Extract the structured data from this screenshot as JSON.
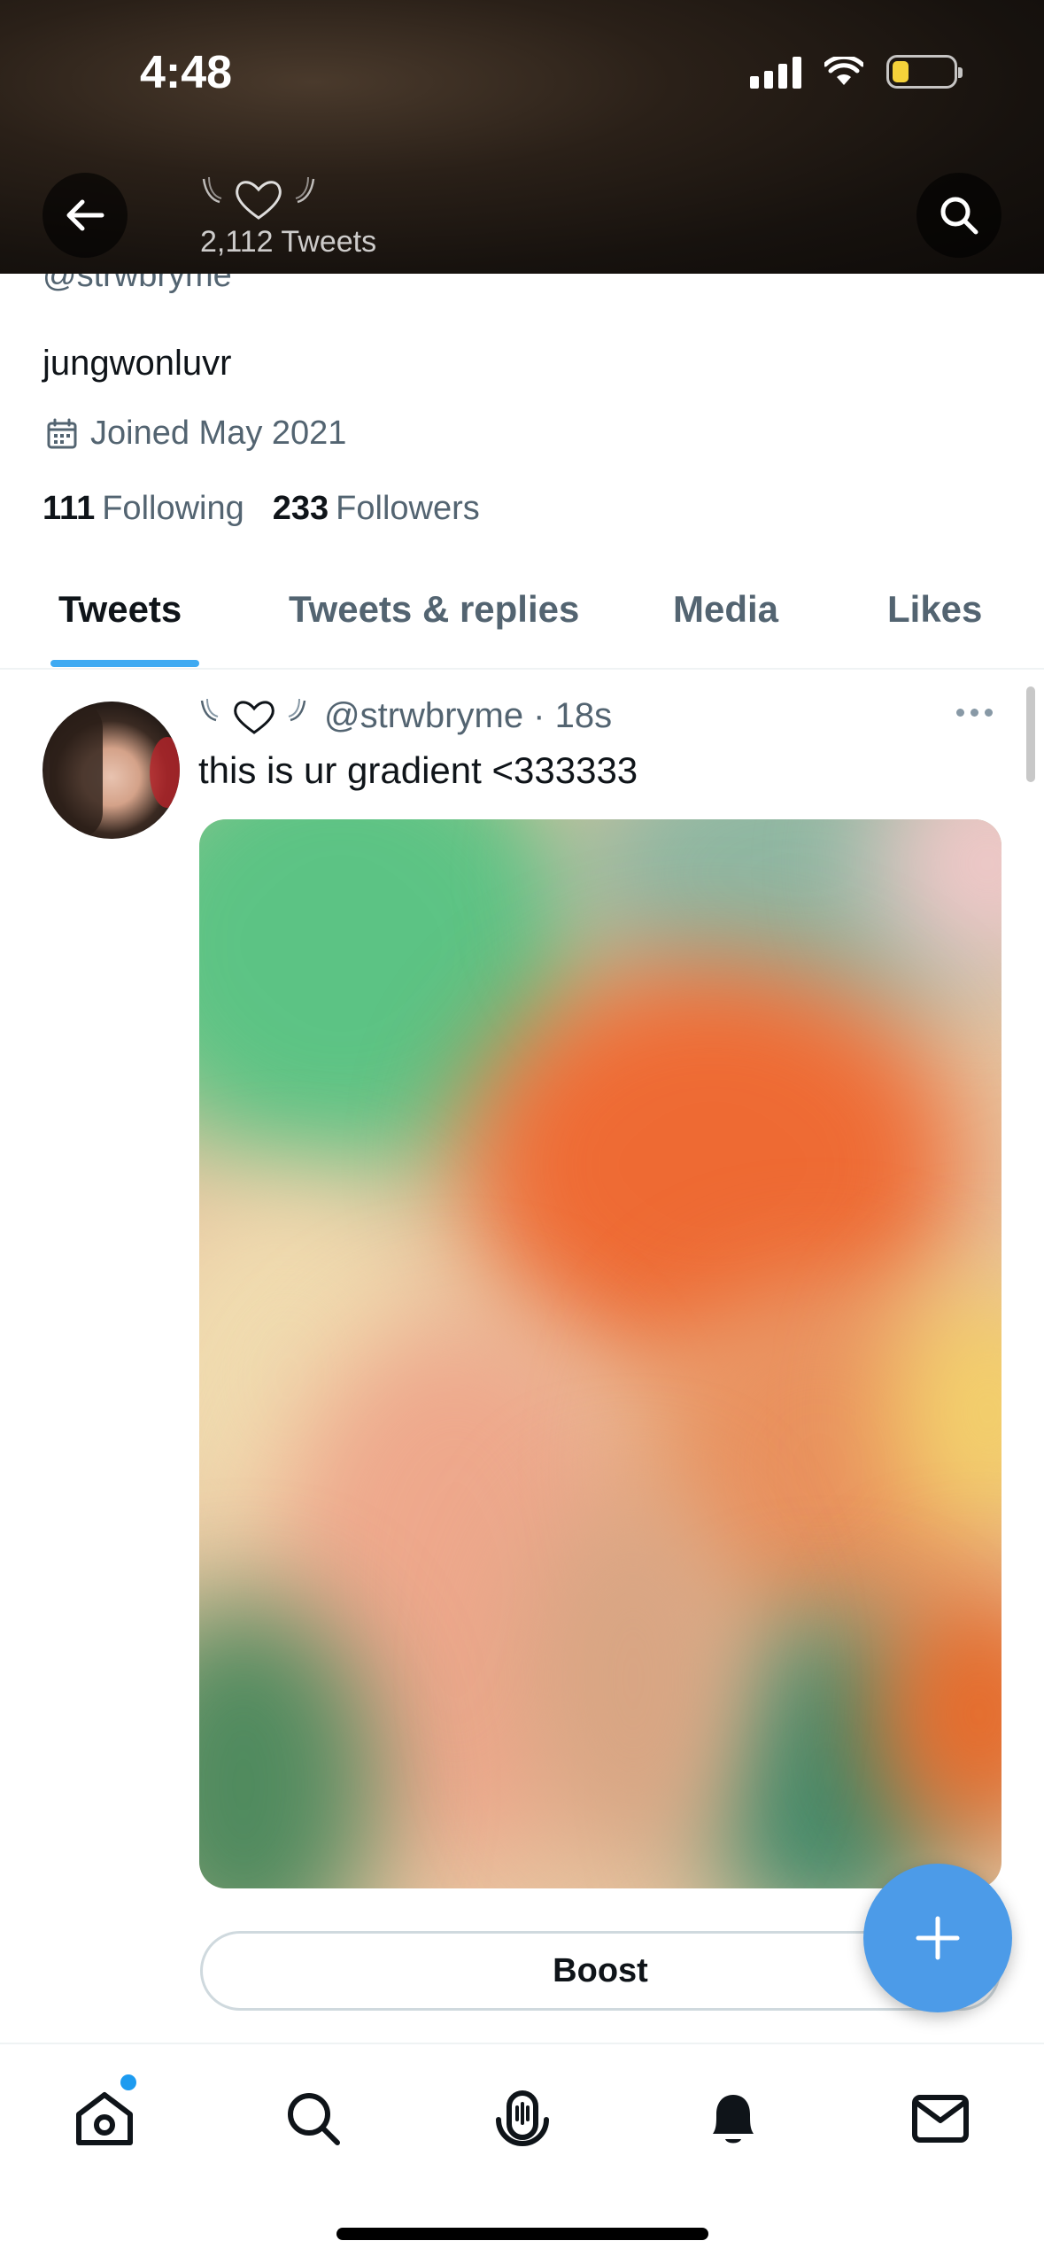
{
  "status_bar": {
    "time": "4:48"
  },
  "header": {
    "name_ornament": "heart-with-wings",
    "tweet_count": "2,112 Tweets"
  },
  "profile": {
    "handle": "@strwbryme",
    "display_name": "jungwonluvr",
    "joined": "Joined May 2021",
    "following_count": "111",
    "following_label": "Following",
    "followers_count": "233",
    "followers_label": "Followers"
  },
  "tabs": [
    {
      "label": "Tweets",
      "active": true
    },
    {
      "label": "Tweets & replies",
      "active": false
    },
    {
      "label": "Media",
      "active": false
    },
    {
      "label": "Likes",
      "active": false
    }
  ],
  "tweet": {
    "handle_time": "@strwbryme · 18s",
    "text": "this is ur gradient <333333",
    "action_button": "Boost"
  },
  "colors": {
    "accent": "#1d9bf0",
    "fab": "#4c9be8",
    "text_secondary": "#536471"
  },
  "icons": [
    "back-arrow-icon",
    "search-icon",
    "calendar-icon",
    "more-icon",
    "plus-icon",
    "home-icon",
    "explore-search-icon",
    "spaces-icon",
    "notifications-bell-icon",
    "messages-mail-icon"
  ]
}
